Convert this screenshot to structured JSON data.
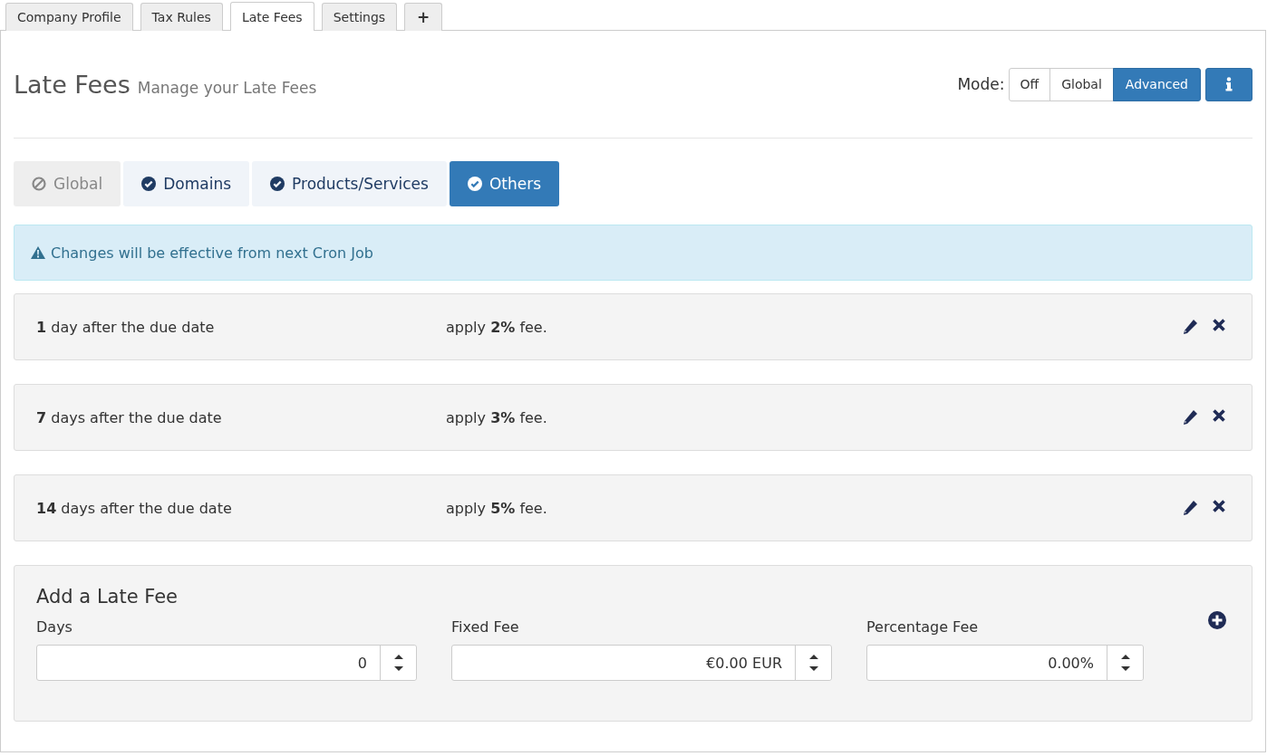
{
  "tabs": [
    {
      "label": "Company Profile",
      "selected": false
    },
    {
      "label": "Tax Rules",
      "selected": false
    },
    {
      "label": "Late Fees",
      "selected": true
    },
    {
      "label": "Settings",
      "selected": false
    },
    {
      "label": "+",
      "selected": false
    }
  ],
  "header": {
    "title": "Late Fees",
    "subtitle": "Manage your Late Fees",
    "mode_label": "Mode:",
    "modes": [
      {
        "label": "Off",
        "selected": false
      },
      {
        "label": "Global",
        "selected": false
      },
      {
        "label": "Advanced",
        "selected": true
      }
    ]
  },
  "scope_tabs": [
    {
      "label": "Global",
      "enabled": false,
      "selected": false
    },
    {
      "label": "Domains",
      "enabled": true,
      "selected": false
    },
    {
      "label": "Products/Services",
      "enabled": true,
      "selected": false
    },
    {
      "label": "Others",
      "enabled": true,
      "selected": true
    }
  ],
  "alert": "Changes will be effective from next Cron Job",
  "fees": [
    {
      "when": "**1** day after the due date",
      "fee": "apply **2%** fee."
    },
    {
      "when": "**7** days after the due date",
      "fee": "apply **3%** fee."
    },
    {
      "when": "**14** days after the due date",
      "fee": "apply **5%** fee."
    }
  ],
  "add_form": {
    "title": "Add a Late Fee",
    "fields": [
      {
        "label": "Days",
        "value": "0"
      },
      {
        "label": "Fixed Fee",
        "value": "€0.00 EUR"
      },
      {
        "label": "Percentage Fee",
        "value": "0.00%"
      }
    ]
  }
}
